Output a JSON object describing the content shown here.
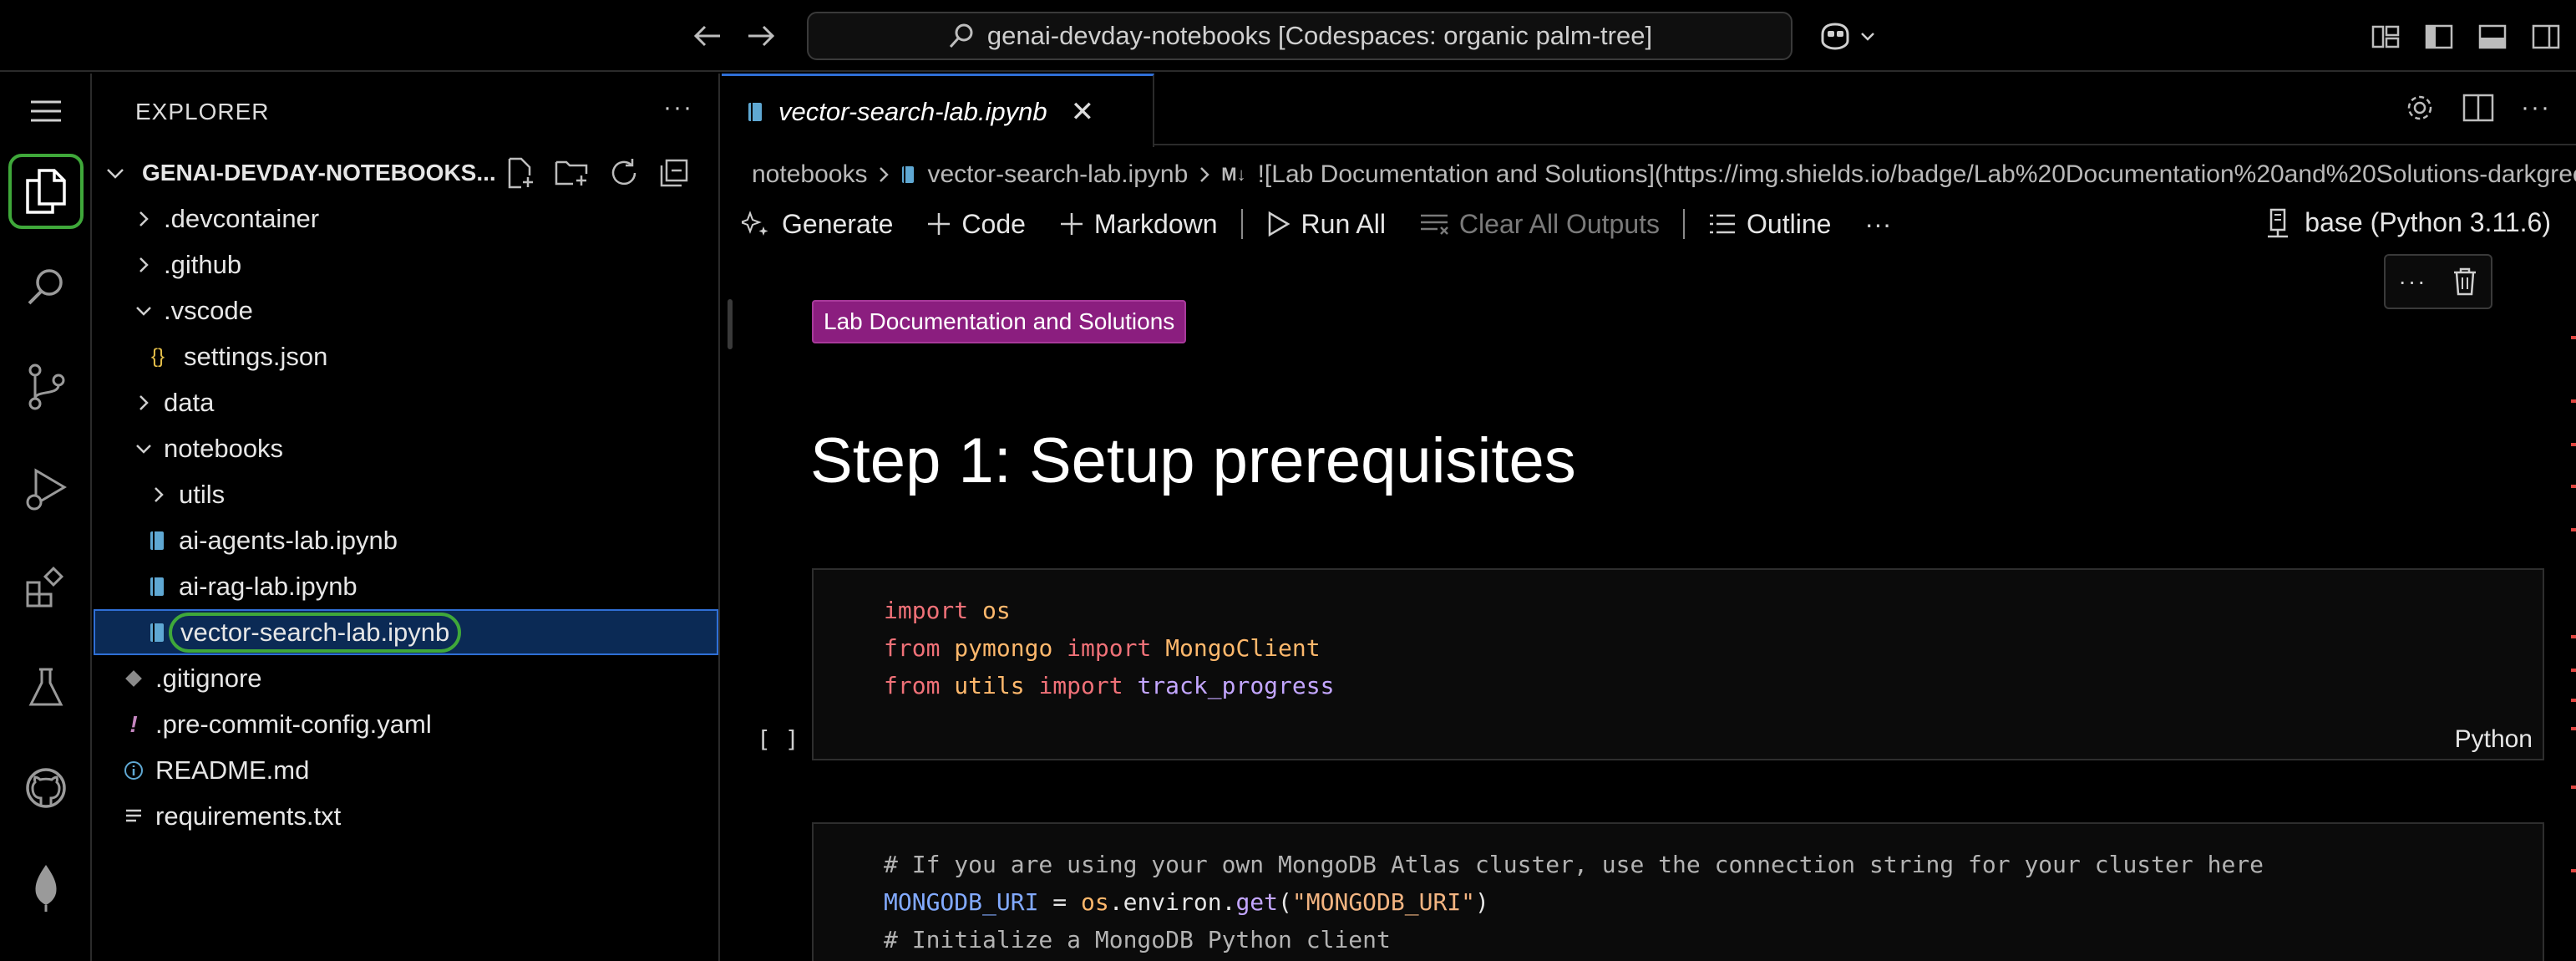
{
  "titlebar": {
    "search_text": "genai-devday-notebooks [Codespaces: organic palm-tree]"
  },
  "sidebar": {
    "title": "EXPLORER",
    "root_label": "GENAI-DEVDAY-NOTEBOOKS...",
    "items": [
      {
        "label": ".devcontainer"
      },
      {
        "label": ".github"
      },
      {
        "label": ".vscode"
      },
      {
        "label": "settings.json"
      },
      {
        "label": "data"
      },
      {
        "label": "notebooks"
      },
      {
        "label": "utils"
      },
      {
        "label": "ai-agents-lab.ipynb"
      },
      {
        "label": "ai-rag-lab.ipynb"
      },
      {
        "label": "vector-search-lab.ipynb"
      },
      {
        "label": ".gitignore"
      },
      {
        "label": ".pre-commit-config.yaml"
      },
      {
        "label": "README.md"
      },
      {
        "label": "requirements.txt"
      }
    ]
  },
  "editor": {
    "tab_label": "vector-search-lab.ipynb",
    "breadcrumb": {
      "folder": "notebooks",
      "file": "vector-search-lab.ipynb",
      "md_tag": "M↓",
      "symbol": "![Lab Documentation and Solutions](https://img.shields.io/badge/Lab%20Documentation%20and%20Solutions-darkgreen)"
    },
    "toolbar": {
      "generate": "Generate",
      "code": "Code",
      "markdown": "Markdown",
      "run_all": "Run All",
      "clear_outputs": "Clear All Outputs",
      "outline": "Outline",
      "more": "···",
      "kernel": "base (Python 3.11.6)"
    },
    "cells": {
      "badge": "Lab Documentation and Solutions",
      "heading": "Step 1: Setup prerequisites",
      "run_indicator": "[ ]",
      "lang": "Python",
      "cell1": {
        "l1_kw": "import",
        "l1_mod": "os",
        "l2_kw1": "from",
        "l2_mod": "pymongo",
        "l2_kw2": "import",
        "l2_cls": "MongoClient",
        "l3_kw1": "from",
        "l3_mod": "utils",
        "l3_kw2": "import",
        "l3_fn": "track_progress"
      },
      "cell2": {
        "comment1": "# If you are using your own MongoDB Atlas cluster, use the connection string for your cluster here",
        "l2_var": "MONGODB_URI",
        "l2_eq": " = ",
        "l2_mod": "os",
        "l2_dot": ".environ.",
        "l2_fn": "get",
        "l2_paren_open": "(",
        "l2_str": "\"MONGODB_URI\"",
        "l2_paren_close": ")",
        "comment2": "# Initialize a MongoDB Python client"
      }
    }
  },
  "colors": {
    "accent_green": "#3fa83a",
    "badge_purple": "#8b1e7f",
    "selection_blue": "#2f6fd6"
  }
}
